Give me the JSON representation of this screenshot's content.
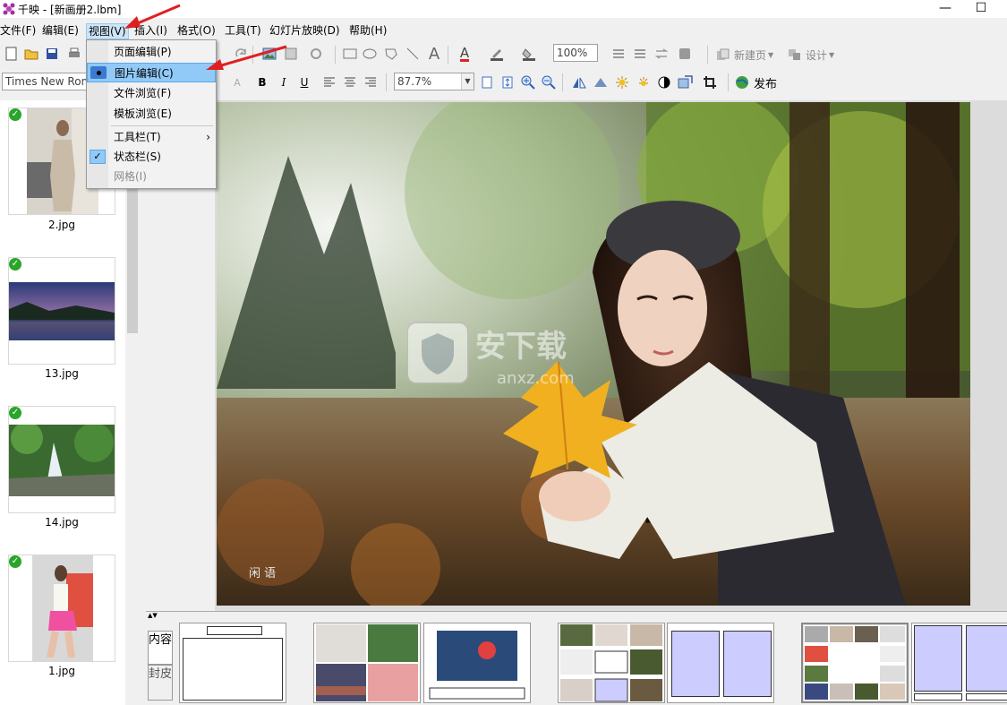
{
  "window": {
    "title": "千映 - [新画册2.lbm]",
    "minimize": "—",
    "maximize": "☐"
  },
  "menubar": {
    "items": [
      "文件(F)",
      "编辑(E)",
      "视图(V)",
      "插入(I)",
      "格式(O)",
      "工具(T)",
      "幻灯片放映(D)",
      "帮助(H)"
    ]
  },
  "toolbar1": {
    "zoom_value": "100%",
    "new_page_label": "新建页",
    "design_label": "设计"
  },
  "toolbar2": {
    "font_name": "Times New Roman",
    "zoom_value": "87.7%",
    "publish_label": "发布"
  },
  "view_menu": {
    "items": [
      {
        "label": "页面编辑(P)",
        "state": "normal"
      },
      {
        "label": "图片编辑(C)",
        "state": "highlighted"
      },
      {
        "label": "文件浏览(F)",
        "state": "normal"
      },
      {
        "label": "模板浏览(E)",
        "state": "normal"
      },
      {
        "label": "工具栏(T)",
        "state": "submenu"
      },
      {
        "label": "状态栏(S)",
        "state": "checked"
      },
      {
        "label": "网格(I)",
        "state": "disabled"
      }
    ]
  },
  "thumbnails": [
    {
      "label": "2.jpg"
    },
    {
      "label": "13.jpg"
    },
    {
      "label": "14.jpg"
    },
    {
      "label": "1.jpg"
    }
  ],
  "watermark": {
    "text_cn": "安下载",
    "text_en": "anxz.com"
  },
  "bottom_tabs": {
    "content": "内容",
    "cover": "封皮"
  },
  "colors": {
    "menu_highlight": "#91c9f7",
    "check_green": "#2aa52a",
    "arrow_red": "#e02020"
  }
}
